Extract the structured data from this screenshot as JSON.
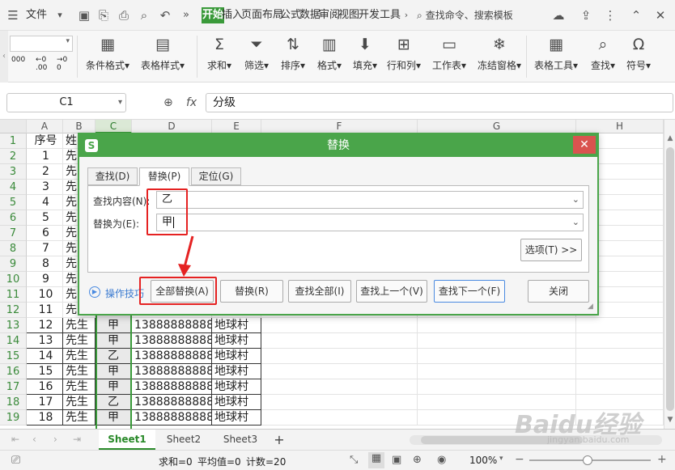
{
  "titlebar": {
    "menu_label": "文件",
    "tabs": [
      "开始",
      "插入",
      "页面布局",
      "公式",
      "数据",
      "审阅",
      "视图",
      "开发工具"
    ],
    "search_label": "查找命令、搜索模板"
  },
  "ribbon": {
    "left_small": {
      "line1": "000",
      "line2a": "←0",
      "line2b": "→0",
      "line3a": "0",
      "line3b": ".00"
    },
    "buttons": [
      "条件格式",
      "表格样式",
      "求和",
      "筛选",
      "排序",
      "格式",
      "填充",
      "行和列",
      "工作表",
      "冻结窗格",
      "表格工具",
      "查找",
      "符号"
    ]
  },
  "formula": {
    "name_box": "C1",
    "fx_label": "fx",
    "value": "分级"
  },
  "columns": [
    "A",
    "B",
    "C",
    "D",
    "E",
    "F",
    "G",
    "H"
  ],
  "rows": [
    {
      "n": "1",
      "a": "序号",
      "b": "姓",
      "c": "",
      "d": "",
      "e": ""
    },
    {
      "n": "2",
      "a": "1",
      "b": "先",
      "c": "",
      "d": "",
      "e": ""
    },
    {
      "n": "3",
      "a": "2",
      "b": "先",
      "c": "",
      "d": "",
      "e": ""
    },
    {
      "n": "4",
      "a": "3",
      "b": "先",
      "c": "",
      "d": "",
      "e": ""
    },
    {
      "n": "5",
      "a": "4",
      "b": "先",
      "c": "",
      "d": "",
      "e": ""
    },
    {
      "n": "6",
      "a": "5",
      "b": "先",
      "c": "",
      "d": "",
      "e": ""
    },
    {
      "n": "7",
      "a": "6",
      "b": "先",
      "c": "",
      "d": "",
      "e": ""
    },
    {
      "n": "8",
      "a": "7",
      "b": "先",
      "c": "",
      "d": "",
      "e": ""
    },
    {
      "n": "9",
      "a": "8",
      "b": "先",
      "c": "",
      "d": "",
      "e": ""
    },
    {
      "n": "10",
      "a": "9",
      "b": "先",
      "c": "",
      "d": "",
      "e": ""
    },
    {
      "n": "11",
      "a": "10",
      "b": "先",
      "c": "",
      "d": "",
      "e": ""
    },
    {
      "n": "12",
      "a": "11",
      "b": "先",
      "c": "",
      "d": "",
      "e": ""
    },
    {
      "n": "13",
      "a": "12",
      "b": "先生",
      "c": "甲",
      "d": "13888888888",
      "e": "地球村"
    },
    {
      "n": "14",
      "a": "13",
      "b": "先生",
      "c": "甲",
      "d": "13888888888",
      "e": "地球村"
    },
    {
      "n": "15",
      "a": "14",
      "b": "先生",
      "c": "乙",
      "d": "13888888888",
      "e": "地球村"
    },
    {
      "n": "16",
      "a": "15",
      "b": "先生",
      "c": "甲",
      "d": "13888888888",
      "e": "地球村"
    },
    {
      "n": "17",
      "a": "16",
      "b": "先生",
      "c": "甲",
      "d": "13888888888",
      "e": "地球村"
    },
    {
      "n": "18",
      "a": "17",
      "b": "先生",
      "c": "乙",
      "d": "13888888888",
      "e": "地球村"
    },
    {
      "n": "19",
      "a": "18",
      "b": "先生",
      "c": "甲",
      "d": "13888888888",
      "e": "地球村"
    }
  ],
  "sheets": [
    "Sheet1",
    "Sheet2",
    "Sheet3"
  ],
  "add_sheet_label": "+",
  "status": {
    "sum": "求和=0",
    "avg": "平均值=0",
    "count": "计数=20",
    "zoom": "100%"
  },
  "dialog": {
    "title": "替换",
    "tabs": [
      "查找(D)",
      "替换(P)",
      "定位(G)"
    ],
    "find_label": "查找内容(N):",
    "find_value": "乙",
    "replace_label": "替换为(E):",
    "replace_value": "甲",
    "options_button": "选项(T) >>",
    "tips_label": "操作技巧",
    "buttons": [
      "全部替换(A)",
      "替换(R)",
      "查找全部(I)",
      "查找上一个(V)",
      "查找下一个(F)",
      "关闭"
    ]
  },
  "watermark": {
    "brand": "Baidu经验",
    "url": "jingyan.baidu.com"
  },
  "colors": {
    "accent": "#4aa54a",
    "highlight": "#e52222"
  }
}
